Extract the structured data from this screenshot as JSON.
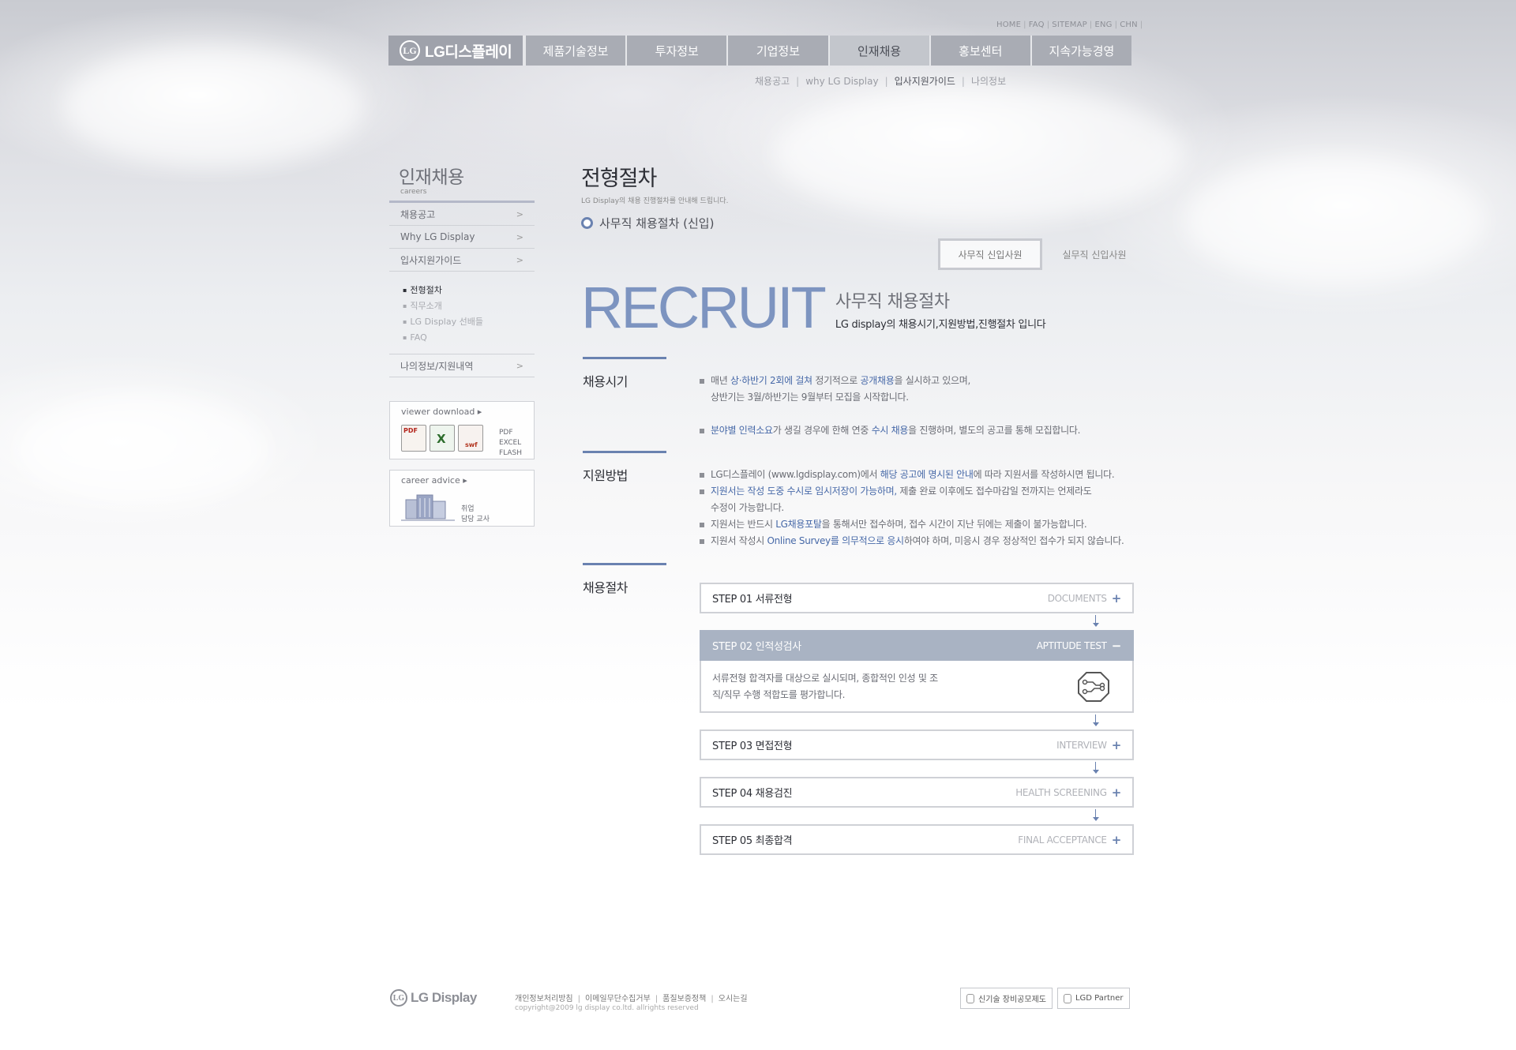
{
  "util_links": [
    "HOME",
    "FAQ",
    "SITEMAP",
    "ENG",
    "CHN"
  ],
  "brand": {
    "logo_text": "LG디스플레이",
    "logo_mark": "LG"
  },
  "gnb": [
    "제품기술정보",
    "투자정보",
    "기업정보",
    "인재채용",
    "홍보센터",
    "지속가능경영"
  ],
  "subnav": [
    "채용공고",
    "why LG Display",
    "입사지원가이드",
    "나의정보"
  ],
  "sidebar": {
    "title": "인재채용",
    "subtitle": "careers",
    "items": [
      "채용공고",
      "Why LG Display",
      "입사지원가이드"
    ],
    "sub_items": [
      "전형절차",
      "직무소개",
      "LG Display 선배들",
      "FAQ"
    ],
    "last_item": "나의정보/지원내역",
    "arrow": ">",
    "viewer": {
      "title": "viewer download ▸",
      "labels": [
        "PDF",
        "EXCEL",
        "FLASH"
      ],
      "icon_text": [
        "PDF",
        "X",
        "swf"
      ]
    },
    "career": {
      "title": "career advice ▸",
      "label1": "취업",
      "label2": "담당 교사"
    }
  },
  "main": {
    "title": "전형절차",
    "desc": "LG Display의 채용 진행절차를 안내해 드립니다.",
    "section_title": "사무직 채용절차 (신입)",
    "tabs": [
      "사무직 신입사원",
      "실무직 신입사원"
    ],
    "recruit_word": "RECRUIT",
    "recruit_title": "사무직 채용절차",
    "recruit_desc": "LG display의 채용시기,지원방법,진행절차 입니다"
  },
  "sections": {
    "timing": {
      "title": "채용시기",
      "b1": {
        "p1": "매년 ",
        "h1": "상·하반기 2회에 걸쳐",
        "p2": " 정기적으로 ",
        "h2": "공개채용",
        "p3": "을 실시하고 있으며,"
      },
      "b1_cont": "상반기는 3월/하반기는 9월부터 모집을 시작합니다.",
      "b2": {
        "h1": "분야별 인력소요",
        "p1": "가 생길 경우에 한해 연중 ",
        "h2": "수시 채용",
        "p2": "을 진행하며, 별도의 공고를 통해 모집합니다."
      }
    },
    "method": {
      "title": "지원방법",
      "b1": {
        "p1": "LG디스플레이 (www.lgdisplay.com)에서 ",
        "h1": "해당 공고에 명시된 안내",
        "p2": "에 따라 지원서를 작성하시면 됩니다."
      },
      "b2": {
        "h1": "지원서는 작성 도중 수시로 임시저장이 가능하며,",
        "p1": " 제출 완료 이후에도 접수마감일 전까지는 언제라도"
      },
      "b2_cont": "수정이 가능합니다.",
      "b3": {
        "p1": "지원서는 반드시 ",
        "h1": "LG채용포탈",
        "p2": "을 통해서만 접수하며, 접수 시간이 지난 뒤에는 제출이 불가능합니다."
      },
      "b4": {
        "p1": "지원서 작성시 ",
        "h1": "Online Survey를 의무적으로 응시",
        "p2": "하여야 하며, 미응시 경우 정상적인 접수가 되지 않습니다."
      }
    },
    "process": {
      "title": "채용절차"
    }
  },
  "steps": [
    {
      "label": "STEP 01 서류전형",
      "eng": "DOCUMENTS",
      "toggle": "+"
    },
    {
      "label": "STEP 02 인적성검사",
      "eng": "APTITUDE TEST",
      "toggle": "−",
      "detail": "서류전형 합격자를 대상으로 실시되며, 종합적인 인성 및 조직/직무 수행 적합도를 평가합니다."
    },
    {
      "label": "STEP 03 면접전형",
      "eng": "INTERVIEW",
      "toggle": "+"
    },
    {
      "label": "STEP 04 채용검진",
      "eng": "HEALTH SCREENING",
      "toggle": "+"
    },
    {
      "label": "STEP 05 최종합격",
      "eng": "FINAL ACCEPTANCE",
      "toggle": "+"
    }
  ],
  "footer": {
    "logo": "LG Display",
    "links": [
      "개인정보처리방침",
      "이메일무단수집거부",
      "품질보증정책",
      "오시는길"
    ],
    "copyright": "copyright@2009 lg display co.ltd. allrights reserved",
    "btn1": "신기술 장비공모제도",
    "btn2": "LGD Partner"
  },
  "colors": {
    "accent": "#6a82b0",
    "gnb": "#a9acb4",
    "highlight": "#4769a8"
  }
}
